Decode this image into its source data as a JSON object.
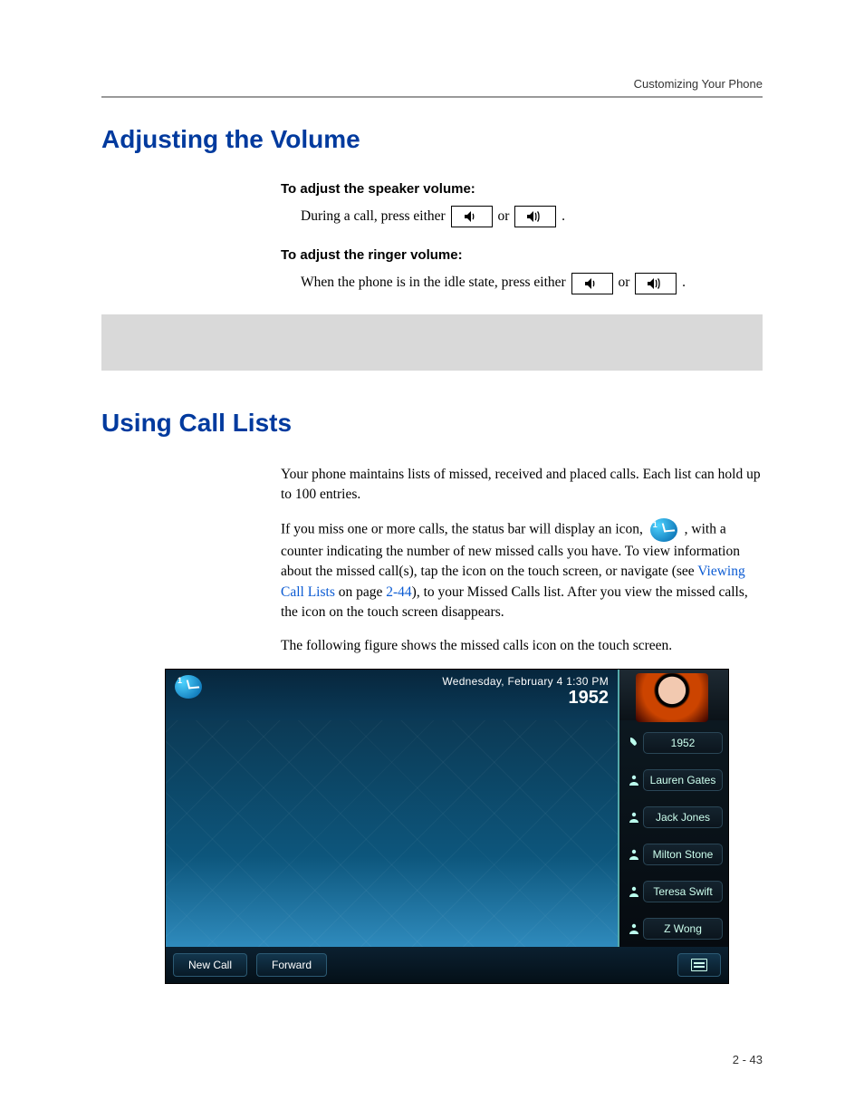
{
  "meta": {
    "running_head": "Customizing Your Phone",
    "page_number": "2 - 43"
  },
  "section1": {
    "title": "Adjusting the Volume",
    "speaker_head": "To adjust the speaker volume:",
    "speaker_line_pre": "During a call, press either ",
    "or_word": " or ",
    "period": " .",
    "ringer_head": "To adjust the ringer volume:",
    "ringer_line_pre": "When the phone is in the idle state, press either "
  },
  "section2": {
    "title": "Using Call Lists",
    "p1": "Your phone maintains lists of missed, received and placed calls. Each list can hold up to 100 entries.",
    "p2_pre": "If you miss one or more calls, the status bar will display an icon, ",
    "p2_post": " , with a counter indicating the number of new missed calls you have. To view information about the missed call(s), tap the icon on the touch screen, or navigate (see ",
    "p2_link": "Viewing Call Lists",
    "p2_mid": " on page ",
    "p2_page": "2-44",
    "p2_end": "), to your Missed Calls list. After you view the missed calls, the icon on the touch screen disappears.",
    "p3": "The following figure shows the missed calls icon on the touch screen."
  },
  "phone": {
    "datetime": "Wednesday, February 4  1:30 PM",
    "extension": "1952",
    "side_items": [
      {
        "label": "1952",
        "icon": "handset"
      },
      {
        "label": "Lauren Gates",
        "icon": "person"
      },
      {
        "label": "Jack Jones",
        "icon": "person"
      },
      {
        "label": "Milton Stone",
        "icon": "person"
      },
      {
        "label": "Teresa Swift",
        "icon": "person"
      },
      {
        "label": "Z Wong",
        "icon": "person"
      }
    ],
    "softkeys": {
      "new_call": "New Call",
      "forward": "Forward"
    }
  }
}
